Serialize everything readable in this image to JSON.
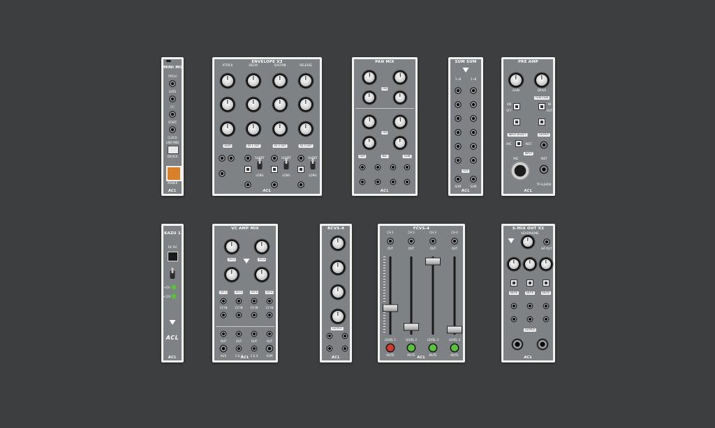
{
  "brand": "ACL",
  "colors": {
    "background": "#3c3e3f",
    "panel": "#7e8284",
    "frame": "#f2f2f2",
    "led_red": "#d13a2c",
    "led_green": "#58c23a"
  },
  "mini_midi": {
    "title": "MINI MIDI",
    "jacks": [
      "PITCH",
      "GATE",
      "CC",
      "START",
      "CLOCK"
    ],
    "usb_label": "USB MIDI",
    "device_label": "DEVICE",
    "bottom_label": "POWER"
  },
  "envelope": {
    "title": "ENVELOPE X3",
    "params": [
      "ATTACK",
      "DECAY",
      "SUSTAIN",
      "RELEASE"
    ],
    "tags": [
      "GATE",
      "EG 1 OUT",
      "EG 2 OUT",
      "EG 3 OUT"
    ],
    "switch_labels": [
      "SHORT",
      "LONG"
    ],
    "pos": [
      "POS",
      "NEG"
    ]
  },
  "pan_mix": {
    "title": "PAN MIX",
    "tags": [
      "OUT",
      "BAL",
      "GAIN"
    ],
    "ch_tag": "ON"
  },
  "sum_sum": {
    "title": "SUM SUM",
    "cols": [
      "1→8",
      "1→8"
    ],
    "out": "OUT",
    "sum": "SUM"
  },
  "pre_amp": {
    "title": "PRE AMP",
    "top": [
      "GAIN",
      "DRIVE"
    ],
    "tags": [
      "FUNCTION",
      "INPUT SELECT",
      "OUTPUT",
      "INPUT"
    ],
    "opts": [
      "ON",
      "OFF",
      "IN",
      "OUT"
    ],
    "mic": "MIC",
    "inst": "INST",
    "model": "TP-LL8404"
  },
  "kazu": {
    "title": "KAZU 1",
    "dc": "DC 9V",
    "labels": [
      "+5V",
      "+12V"
    ]
  },
  "vc_amp": {
    "title": "VC AMP MIX",
    "channels": [
      "CH 1",
      "CH 2",
      "CH 3",
      "CH 4"
    ],
    "knob": "GAIN",
    "cv": "CV IN",
    "out_labels": [
      "AUX",
      "1 & 2",
      "2 & 4",
      "SUM"
    ],
    "out": "OUT"
  },
  "rcvs": {
    "title": "RCVS-4",
    "out": "OUTPUT"
  },
  "fcvs": {
    "title": "FCVS-4",
    "ch": [
      "CH 1",
      "CH 2",
      "CH 3",
      "CH 4"
    ],
    "out": "OUT",
    "levels": [
      "LEVEL 1",
      "LEVEL 2",
      "LEVEL 3",
      "LEVEL 4"
    ],
    "mute": "MUTE"
  },
  "smix": {
    "title": "S-MIX OUT X3",
    "headphone": "HEADPHONE",
    "tags": [
      "MUTE",
      "MUTE",
      "MUTE"
    ],
    "output": "OUTPUT",
    "hp": "HP OUT"
  }
}
